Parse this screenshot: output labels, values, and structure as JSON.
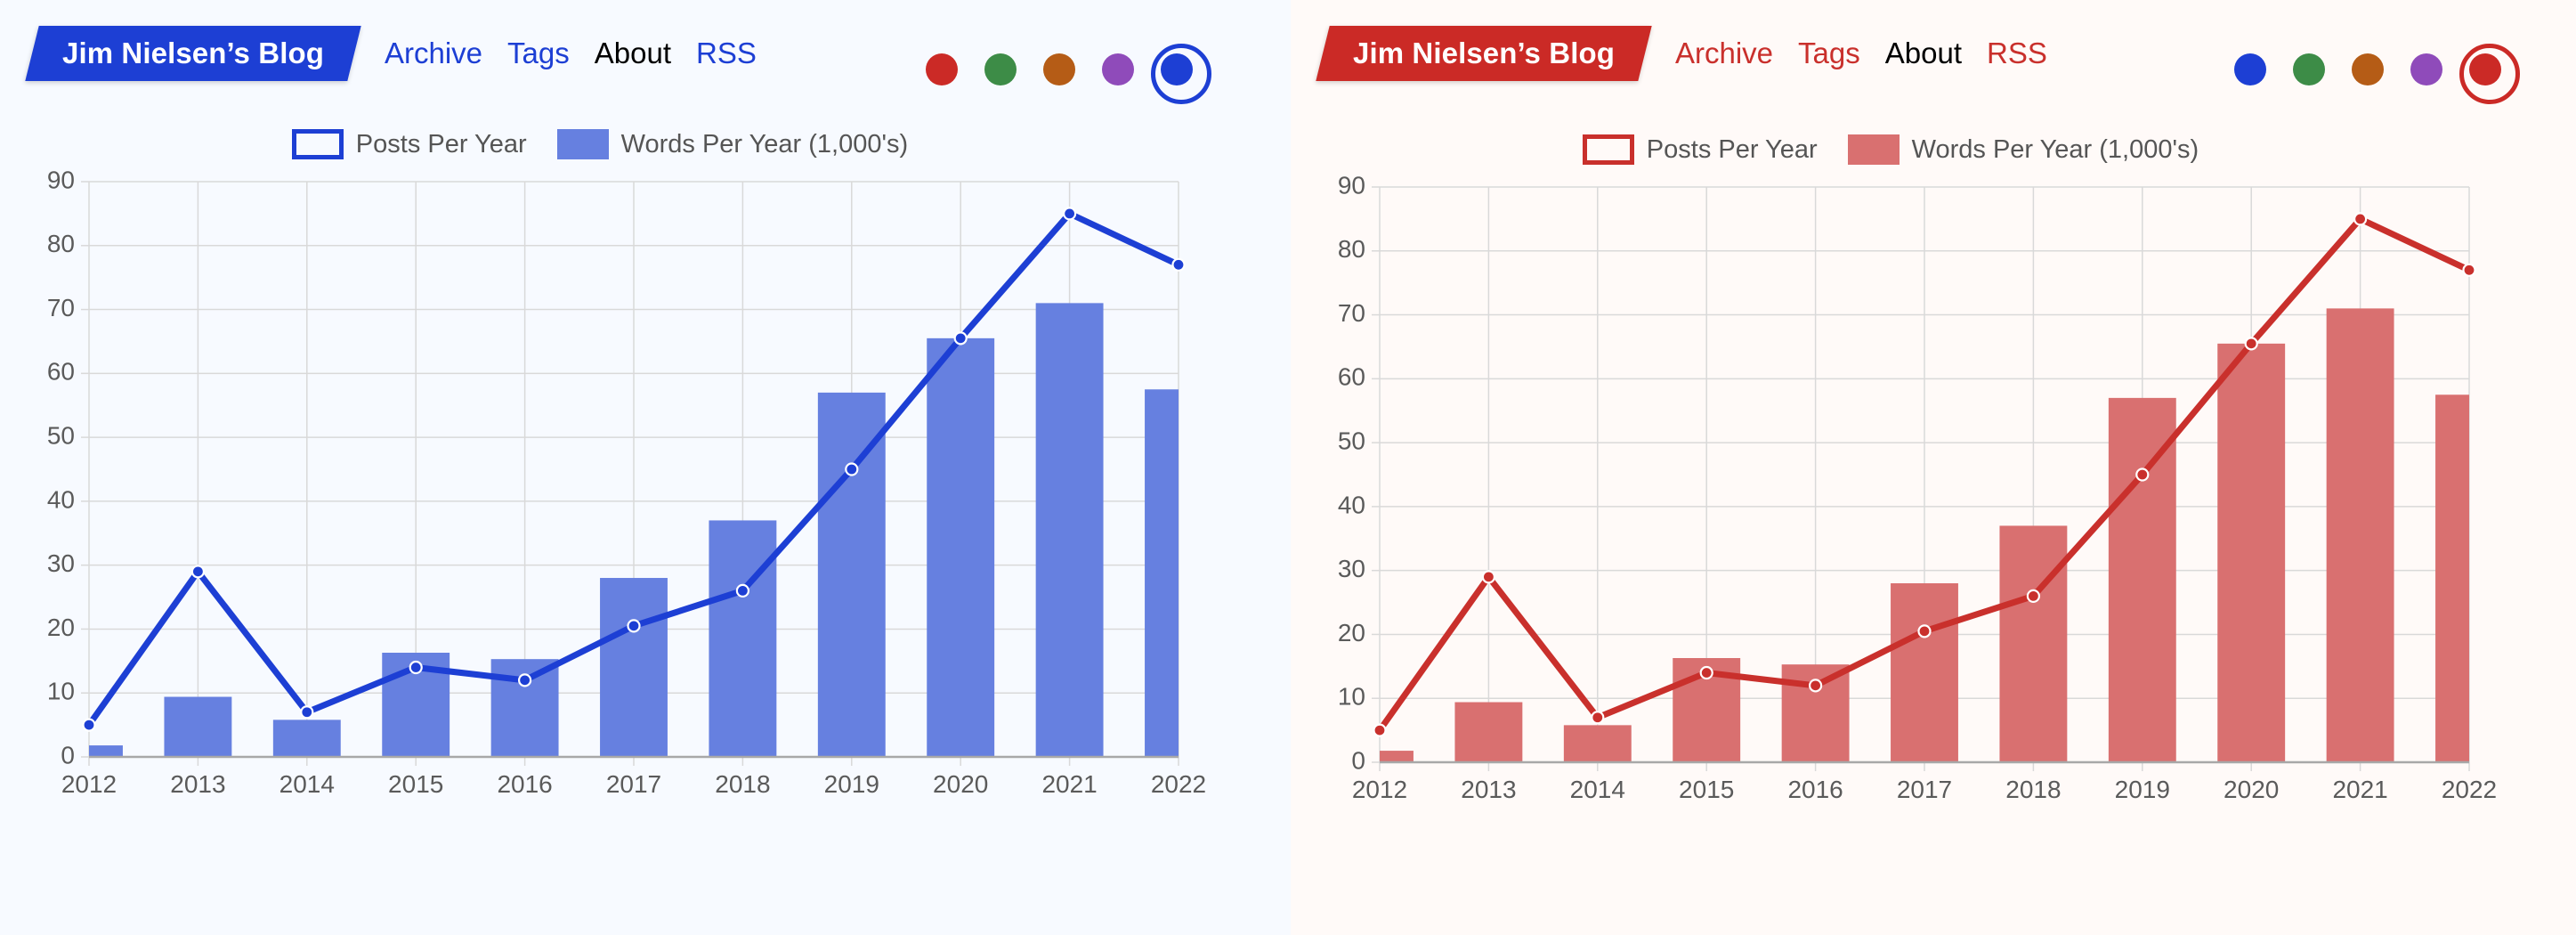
{
  "panels": [
    {
      "theme_name": "blue",
      "background": "#f7faff",
      "accent": "#1d3fd4",
      "bar_color": "#6680e0",
      "line_color": "#1d3fd4",
      "logo_bg": "#1d3fd4",
      "header": {
        "logo_text": "Jim Nielsen’s Blog",
        "nav": [
          {
            "label": "Archive",
            "current": false
          },
          {
            "label": "Tags",
            "current": false
          },
          {
            "label": "About",
            "current": true
          },
          {
            "label": "RSS",
            "current": false
          }
        ],
        "swatches": [
          {
            "name": "red",
            "color": "#cb2a26",
            "selected": false
          },
          {
            "name": "green",
            "color": "#3d8c47",
            "selected": false
          },
          {
            "name": "orange",
            "color": "#b55c16",
            "selected": false
          },
          {
            "name": "purple",
            "color": "#8f4bba",
            "selected": false
          },
          {
            "name": "blue",
            "color": "#1d3fd4",
            "selected": true
          }
        ]
      },
      "chart_data": {
        "type": "bar",
        "title": "",
        "xlabel": "",
        "ylabel": "",
        "ylim": [
          0,
          90
        ],
        "yticks": [
          0,
          10,
          20,
          30,
          40,
          50,
          60,
          70,
          80,
          90
        ],
        "grid": true,
        "legend_position": "top-center",
        "categories": [
          "2012",
          "2013",
          "2014",
          "2015",
          "2016",
          "2017",
          "2018",
          "2019",
          "2020",
          "2021",
          "2022"
        ],
        "series": [
          {
            "name": "Words Per Year (1,000's)",
            "render": "bar",
            "color": "#6680e0",
            "values": [
              1.8,
              9.4,
              5.8,
              16.3,
              15.3,
              28.0,
              37.0,
              57.0,
              65.5,
              71.0,
              57.5
            ]
          },
          {
            "name": "Posts Per Year",
            "render": "line",
            "color": "#1d3fd4",
            "values": [
              5,
              29,
              7,
              14,
              12,
              20.5,
              26,
              45,
              65.5,
              85,
              77
            ]
          }
        ]
      }
    },
    {
      "theme_name": "red",
      "background": "#fffaf8",
      "accent": "#c9302c",
      "bar_color": "#d97070",
      "line_color": "#c9302c",
      "logo_bg": "#cb2a26",
      "header": {
        "logo_text": "Jim Nielsen’s Blog",
        "nav": [
          {
            "label": "Archive",
            "current": false
          },
          {
            "label": "Tags",
            "current": false
          },
          {
            "label": "About",
            "current": true
          },
          {
            "label": "RSS",
            "current": false
          }
        ],
        "swatches": [
          {
            "name": "blue",
            "color": "#1d3fd4",
            "selected": false
          },
          {
            "name": "green",
            "color": "#3d8c47",
            "selected": false
          },
          {
            "name": "orange",
            "color": "#b55c16",
            "selected": false
          },
          {
            "name": "purple",
            "color": "#8f4bba",
            "selected": false
          },
          {
            "name": "red",
            "color": "#cb2a26",
            "selected": true
          }
        ]
      },
      "chart_data": {
        "type": "bar",
        "title": "",
        "xlabel": "",
        "ylabel": "",
        "ylim": [
          0,
          90
        ],
        "yticks": [
          0,
          10,
          20,
          30,
          40,
          50,
          60,
          70,
          80,
          90
        ],
        "grid": true,
        "legend_position": "top-center",
        "categories": [
          "2012",
          "2013",
          "2014",
          "2015",
          "2016",
          "2017",
          "2018",
          "2019",
          "2020",
          "2021",
          "2022"
        ],
        "series": [
          {
            "name": "Words Per Year (1,000's)",
            "render": "bar",
            "color": "#d97070",
            "values": [
              1.8,
              9.4,
              5.8,
              16.3,
              15.3,
              28.0,
              37.0,
              57.0,
              65.5,
              71.0,
              57.5
            ]
          },
          {
            "name": "Posts Per Year",
            "render": "line",
            "color": "#c9302c",
            "values": [
              5,
              29,
              7,
              14,
              12,
              20.5,
              26,
              45,
              65.5,
              85,
              77
            ]
          }
        ]
      }
    }
  ]
}
